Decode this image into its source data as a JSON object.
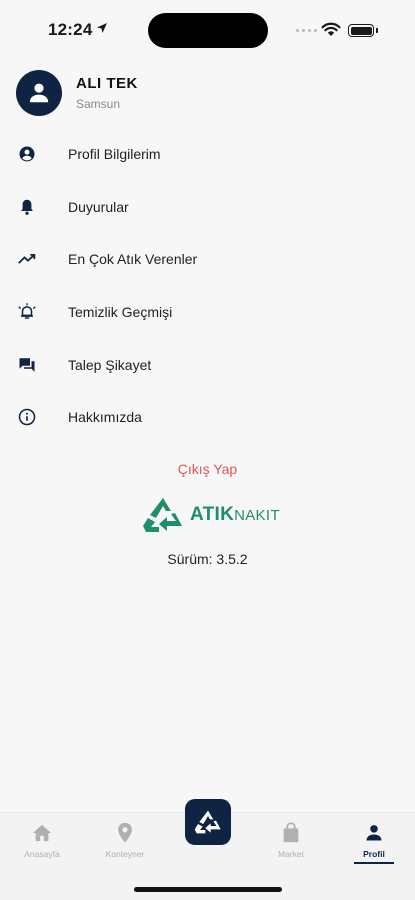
{
  "status_bar": {
    "time": "12:24"
  },
  "profile": {
    "name": "ALI TEK",
    "city": "Samsun"
  },
  "menu": [
    {
      "label": "Profil Bilgilerim",
      "icon": "account-circle-icon"
    },
    {
      "label": "Duyurular",
      "icon": "bell-icon"
    },
    {
      "label": "En Çok Atık Verenler",
      "icon": "trending-up-icon"
    },
    {
      "label": "Temizlik Geçmişi",
      "icon": "alarm-icon"
    },
    {
      "label": "Talep Şikayet",
      "icon": "chat-icon"
    },
    {
      "label": "Hakkımızda",
      "icon": "info-icon"
    }
  ],
  "logout_label": "Çıkış Yap",
  "logo": {
    "part1": "ATIK",
    "part2": "NAKIT"
  },
  "version_label": "Sürüm: 3.5.2",
  "nav": [
    {
      "label": "Anasayfa",
      "icon": "home-icon"
    },
    {
      "label": "Konteyner",
      "icon": "location-pin-icon"
    },
    {
      "label": "",
      "icon": "recycle-icon"
    },
    {
      "label": "Market",
      "icon": "shopping-bag-icon"
    },
    {
      "label": "Profil",
      "icon": "person-icon"
    }
  ],
  "colors": {
    "primary": "#0f2443",
    "logout": "#e05555",
    "brand": "#1e8f6a"
  }
}
